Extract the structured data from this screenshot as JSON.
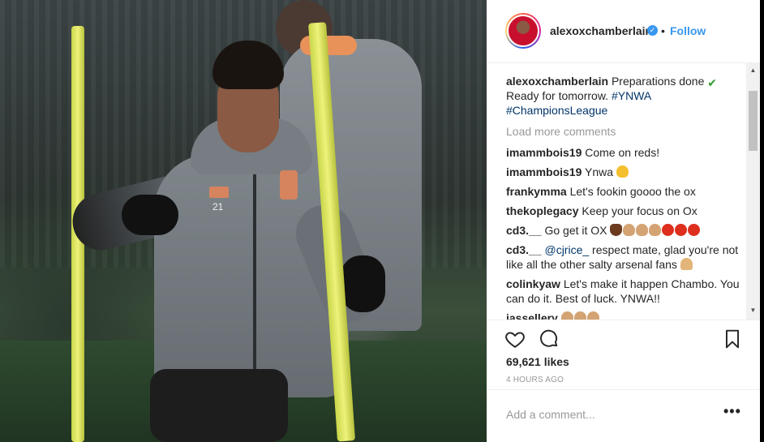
{
  "post": {
    "username": "alexoxchamberlain",
    "verified_icon": "verified-badge-icon",
    "separator": "•",
    "follow_label": "Follow",
    "caption": {
      "username": "alexoxchamberlain",
      "text_1": "Preparations done",
      "text_2": "Ready for tomorrow.",
      "hashtag_1": "#YNWA",
      "hashtag_2": "#ChampionsLeague"
    },
    "load_more_label": "Load more comments",
    "comments": [
      {
        "user": "imammbois19",
        "text": "Come on reds!"
      },
      {
        "user": "imammbois19",
        "text": "Ynwa"
      },
      {
        "user": "frankymma",
        "text": "Let's fookin goooo the ox"
      },
      {
        "user": "thekoplegacy",
        "text": "Keep your focus on Ox"
      },
      {
        "user": "cd3.__",
        "text": "Go get it OX"
      },
      {
        "user": "cd3.__",
        "mention": "@cjrice_",
        "text": "respect mate, glad you're not like all the other salty arsenal fans"
      },
      {
        "user": "colinkyaw",
        "text": "Let's make it happen Chambo. You can do it. Best of luck. YNWA!!"
      },
      {
        "user": "jassellery",
        "text": ""
      }
    ],
    "likes": "69,621 likes",
    "time": "4 HOURS AGO",
    "add_comment_placeholder": "Add a comment...",
    "more_label": "•••"
  },
  "photo": {
    "jersey_number": "21"
  },
  "colors": {
    "follow": "#3897f0",
    "hashtag": "#003569",
    "muted": "#999999",
    "text": "#262626"
  }
}
